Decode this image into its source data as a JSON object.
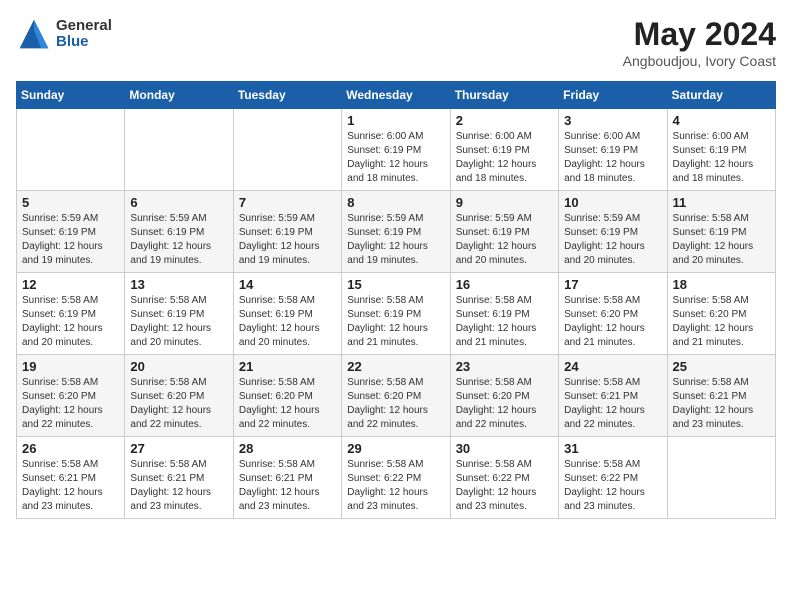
{
  "header": {
    "logo_general": "General",
    "logo_blue": "Blue",
    "month_title": "May 2024",
    "location": "Angboudjou, Ivory Coast"
  },
  "weekdays": [
    "Sunday",
    "Monday",
    "Tuesday",
    "Wednesday",
    "Thursday",
    "Friday",
    "Saturday"
  ],
  "weeks": [
    [
      {
        "day": "",
        "info": ""
      },
      {
        "day": "",
        "info": ""
      },
      {
        "day": "",
        "info": ""
      },
      {
        "day": "1",
        "info": "Sunrise: 6:00 AM\nSunset: 6:19 PM\nDaylight: 12 hours\nand 18 minutes."
      },
      {
        "day": "2",
        "info": "Sunrise: 6:00 AM\nSunset: 6:19 PM\nDaylight: 12 hours\nand 18 minutes."
      },
      {
        "day": "3",
        "info": "Sunrise: 6:00 AM\nSunset: 6:19 PM\nDaylight: 12 hours\nand 18 minutes."
      },
      {
        "day": "4",
        "info": "Sunrise: 6:00 AM\nSunset: 6:19 PM\nDaylight: 12 hours\nand 18 minutes."
      }
    ],
    [
      {
        "day": "5",
        "info": "Sunrise: 5:59 AM\nSunset: 6:19 PM\nDaylight: 12 hours\nand 19 minutes."
      },
      {
        "day": "6",
        "info": "Sunrise: 5:59 AM\nSunset: 6:19 PM\nDaylight: 12 hours\nand 19 minutes."
      },
      {
        "day": "7",
        "info": "Sunrise: 5:59 AM\nSunset: 6:19 PM\nDaylight: 12 hours\nand 19 minutes."
      },
      {
        "day": "8",
        "info": "Sunrise: 5:59 AM\nSunset: 6:19 PM\nDaylight: 12 hours\nand 19 minutes."
      },
      {
        "day": "9",
        "info": "Sunrise: 5:59 AM\nSunset: 6:19 PM\nDaylight: 12 hours\nand 20 minutes."
      },
      {
        "day": "10",
        "info": "Sunrise: 5:59 AM\nSunset: 6:19 PM\nDaylight: 12 hours\nand 20 minutes."
      },
      {
        "day": "11",
        "info": "Sunrise: 5:58 AM\nSunset: 6:19 PM\nDaylight: 12 hours\nand 20 minutes."
      }
    ],
    [
      {
        "day": "12",
        "info": "Sunrise: 5:58 AM\nSunset: 6:19 PM\nDaylight: 12 hours\nand 20 minutes."
      },
      {
        "day": "13",
        "info": "Sunrise: 5:58 AM\nSunset: 6:19 PM\nDaylight: 12 hours\nand 20 minutes."
      },
      {
        "day": "14",
        "info": "Sunrise: 5:58 AM\nSunset: 6:19 PM\nDaylight: 12 hours\nand 20 minutes."
      },
      {
        "day": "15",
        "info": "Sunrise: 5:58 AM\nSunset: 6:19 PM\nDaylight: 12 hours\nand 21 minutes."
      },
      {
        "day": "16",
        "info": "Sunrise: 5:58 AM\nSunset: 6:19 PM\nDaylight: 12 hours\nand 21 minutes."
      },
      {
        "day": "17",
        "info": "Sunrise: 5:58 AM\nSunset: 6:20 PM\nDaylight: 12 hours\nand 21 minutes."
      },
      {
        "day": "18",
        "info": "Sunrise: 5:58 AM\nSunset: 6:20 PM\nDaylight: 12 hours\nand 21 minutes."
      }
    ],
    [
      {
        "day": "19",
        "info": "Sunrise: 5:58 AM\nSunset: 6:20 PM\nDaylight: 12 hours\nand 22 minutes."
      },
      {
        "day": "20",
        "info": "Sunrise: 5:58 AM\nSunset: 6:20 PM\nDaylight: 12 hours\nand 22 minutes."
      },
      {
        "day": "21",
        "info": "Sunrise: 5:58 AM\nSunset: 6:20 PM\nDaylight: 12 hours\nand 22 minutes."
      },
      {
        "day": "22",
        "info": "Sunrise: 5:58 AM\nSunset: 6:20 PM\nDaylight: 12 hours\nand 22 minutes."
      },
      {
        "day": "23",
        "info": "Sunrise: 5:58 AM\nSunset: 6:20 PM\nDaylight: 12 hours\nand 22 minutes."
      },
      {
        "day": "24",
        "info": "Sunrise: 5:58 AM\nSunset: 6:21 PM\nDaylight: 12 hours\nand 22 minutes."
      },
      {
        "day": "25",
        "info": "Sunrise: 5:58 AM\nSunset: 6:21 PM\nDaylight: 12 hours\nand 23 minutes."
      }
    ],
    [
      {
        "day": "26",
        "info": "Sunrise: 5:58 AM\nSunset: 6:21 PM\nDaylight: 12 hours\nand 23 minutes."
      },
      {
        "day": "27",
        "info": "Sunrise: 5:58 AM\nSunset: 6:21 PM\nDaylight: 12 hours\nand 23 minutes."
      },
      {
        "day": "28",
        "info": "Sunrise: 5:58 AM\nSunset: 6:21 PM\nDaylight: 12 hours\nand 23 minutes."
      },
      {
        "day": "29",
        "info": "Sunrise: 5:58 AM\nSunset: 6:22 PM\nDaylight: 12 hours\nand 23 minutes."
      },
      {
        "day": "30",
        "info": "Sunrise: 5:58 AM\nSunset: 6:22 PM\nDaylight: 12 hours\nand 23 minutes."
      },
      {
        "day": "31",
        "info": "Sunrise: 5:58 AM\nSunset: 6:22 PM\nDaylight: 12 hours\nand 23 minutes."
      },
      {
        "day": "",
        "info": ""
      }
    ]
  ]
}
